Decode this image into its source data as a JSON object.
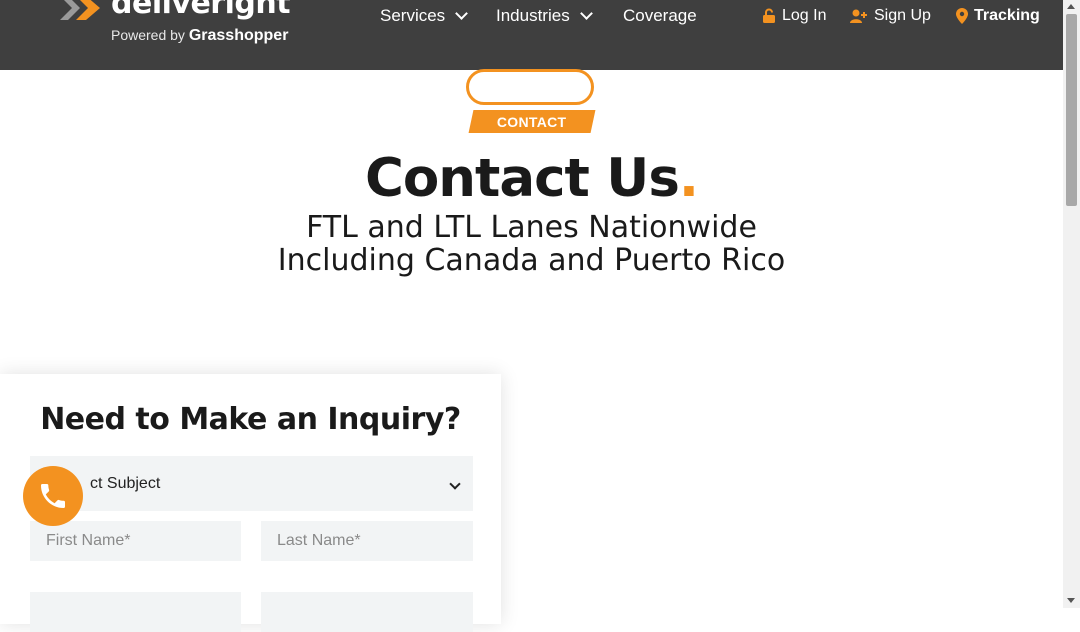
{
  "header": {
    "logo_text": "deliveright",
    "logo_sub_prefix": "Powered by",
    "logo_sub_brand": "Grasshopper",
    "nav": [
      {
        "label": "Services",
        "has_dropdown": true
      },
      {
        "label": "Industries",
        "has_dropdown": true
      },
      {
        "label": "Coverage",
        "has_dropdown": false
      }
    ],
    "utility": {
      "login": "Log In",
      "signup": "Sign Up",
      "tracking": "Tracking"
    }
  },
  "hero": {
    "tag": "CONTACT",
    "title": "Contact Us",
    "title_dot": ".",
    "subtitle_line1": "FTL and LTL Lanes Nationwide",
    "subtitle_line2": "Including Canada and Puerto Rico"
  },
  "form": {
    "heading": "Need to Make an Inquiry?",
    "subject_visible": "ct Subject",
    "first_name_placeholder": "First Name*",
    "last_name_placeholder": "Last Name*"
  },
  "icons": {
    "login": "lock-icon",
    "signup": "user-plus-icon",
    "tracking": "map-pin-icon",
    "fab": "phone-icon"
  },
  "colors": {
    "accent": "#f39220",
    "header_bg": "#3f3f3f",
    "field_bg": "#f2f4f5"
  }
}
